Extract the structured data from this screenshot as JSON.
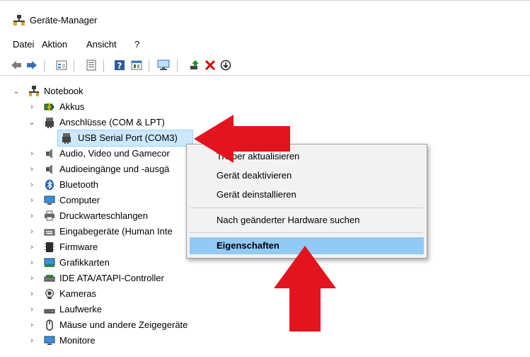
{
  "window": {
    "title": "Geräte-Manager"
  },
  "menu": [
    "Datei",
    "Aktion",
    "Ansicht",
    "?"
  ],
  "toolbar": {
    "back_icon": "arrow-left-icon",
    "forward_icon": "arrow-right-icon",
    "remove_color": "#d40000",
    "update_color": "#2a8c2a"
  },
  "tree": {
    "root": "Notebook",
    "items": [
      "Akkus",
      "Anschlüsse (COM & LPT)",
      "USB Serial Port (COM3)",
      "Audio, Video und Gamecor",
      "Audioeingänge und -ausgä",
      "Bluetooth",
      "Computer",
      "Druckwarteschlangen",
      "Eingabegeräte (Human Inte",
      "Firmware",
      "Grafikkarten",
      "IDE ATA/ATAPI-Controller",
      "Kameras",
      "Laufwerke",
      "Mäuse und andere Zeigegeräte",
      "Monitore"
    ]
  },
  "context_menu": {
    "items": [
      "Treiber aktualisieren",
      "Gerät deaktivieren",
      "Gerät deinstallieren",
      "Nach geänderter Hardware suchen",
      "Eigenschaften"
    ]
  },
  "colors": {
    "selection": "#cce8ff",
    "menu_highlight": "#91c9f7",
    "annotation_arrow": "#e3141e"
  }
}
